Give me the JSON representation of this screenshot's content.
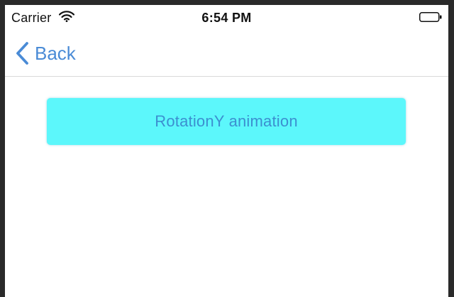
{
  "status_bar": {
    "carrier": "Carrier",
    "time": "6:54 PM",
    "wifi_icon": "wifi-icon",
    "battery_icon": "battery-icon"
  },
  "nav": {
    "back_label": "Back",
    "back_icon": "chevron-left-icon"
  },
  "main": {
    "button_label": "RotationY animation"
  },
  "colors": {
    "tint": "#4a8bd6",
    "button_bg": "#5cf7fb",
    "button_text": "#3c8fd0"
  }
}
